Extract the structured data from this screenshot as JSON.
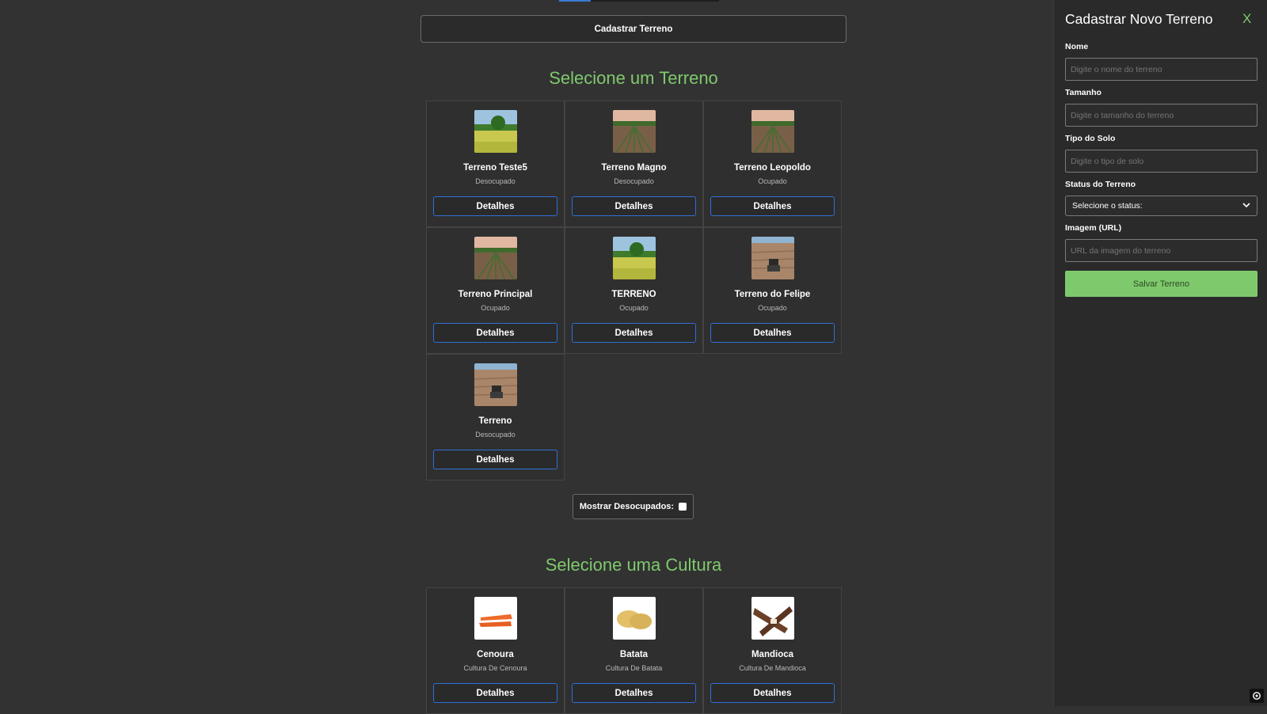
{
  "header": {
    "cadastrar_label": "Cadastrar Terreno"
  },
  "terrenos": {
    "title": "Selecione um Terreno",
    "items": [
      {
        "name": "Terreno Teste5",
        "status": "Desocupado",
        "image": "grass-field-icon",
        "details_label": "Detalhes"
      },
      {
        "name": "Terreno Magno",
        "status": "Desocupado",
        "image": "plowed-field-icon",
        "details_label": "Detalhes"
      },
      {
        "name": "Terreno Leopoldo",
        "status": "Ocupado",
        "image": "plowed-field-icon",
        "details_label": "Detalhes"
      },
      {
        "name": "Terreno Principal",
        "status": "Ocupado",
        "image": "plowed-field-icon",
        "details_label": "Detalhes"
      },
      {
        "name": "TERRENO",
        "status": "Ocupado",
        "image": "grass-field-icon",
        "details_label": "Detalhes"
      },
      {
        "name": "Terreno do Felipe",
        "status": "Ocupado",
        "image": "tractor-field-icon",
        "details_label": "Detalhes"
      },
      {
        "name": "Terreno",
        "status": "Desocupado",
        "image": "tractor-field-icon",
        "details_label": "Detalhes"
      }
    ],
    "toggle_label": "Mostrar Desocupados:"
  },
  "culturas": {
    "title": "Selecione uma Cultura",
    "items": [
      {
        "name": "Cenoura",
        "desc": "Cultura De Cenoura",
        "image": "carrot-icon",
        "details_label": "Detalhes"
      },
      {
        "name": "Batata",
        "desc": "Cultura De Batata",
        "image": "potato-icon",
        "details_label": "Detalhes"
      },
      {
        "name": "Mandioca",
        "desc": "Cultura De Mandioca",
        "image": "cassava-icon",
        "details_label": "Detalhes"
      }
    ]
  },
  "panel": {
    "title": "Cadastrar Novo Terreno",
    "close_label": "X",
    "fields": {
      "nome_label": "Nome",
      "nome_placeholder": "Digite o nome do terreno",
      "tamanho_label": "Tamanho",
      "tamanho_placeholder": "Digite o tamanho do terreno",
      "solo_label": "Tipo do Solo",
      "solo_placeholder": "Digite o tipo de solo",
      "status_label": "Status do Terreno",
      "status_selected": "Selecione o status:",
      "imagem_label": "Imagem (URL)",
      "imagem_placeholder": "URL da imagem do terreno"
    },
    "save_label": "Salvar Terreno"
  },
  "colors": {
    "accent_green": "#7fc96d",
    "accent_blue": "#2f6fd6",
    "background": "#323232"
  }
}
